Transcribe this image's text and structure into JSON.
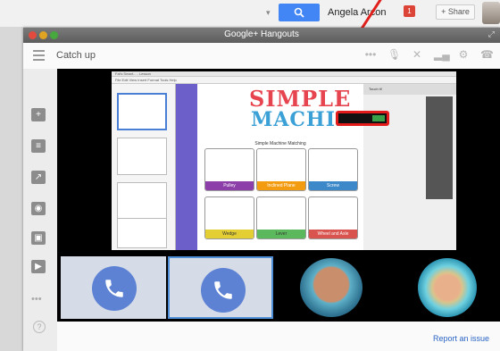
{
  "browser_bar": {
    "user_name": "Angela Arcon",
    "notification_count": "1",
    "share_label": "+ Share"
  },
  "window": {
    "title": "Google+ Hangouts",
    "call_title": "Catch up"
  },
  "toolbar": {
    "icons": [
      "mic-icon",
      "camera-off-icon",
      "signal-icon",
      "settings-icon",
      "leave-call-icon"
    ]
  },
  "sidebar": {
    "items": [
      "invite-people-icon",
      "chat-icon",
      "screenshare-icon",
      "camera-icon",
      "capture-icon",
      "youtube-icon"
    ],
    "more_label": "•••",
    "help_label": "?"
  },
  "shared_screen": {
    "app_title_bar": "Fal's Smart... - Lesson",
    "menu_bar": "File  Edit  View  Insert  Format  Tools  Help",
    "right_header": "Touch it!",
    "lesson_title_line1": "SIMPLE",
    "lesson_title_line2": "MACHINES",
    "subtitle": "Simple Machine Matching",
    "cards": [
      {
        "label": "Pulley",
        "color": "#8c3fa8"
      },
      {
        "label": "Inclined Plane",
        "color": "#f39c12"
      },
      {
        "label": "Screw",
        "color": "#3d88c8"
      },
      {
        "label": "Wedge",
        "color": "#e3cf33"
      },
      {
        "label": "Lever",
        "color": "#5cb85c"
      },
      {
        "label": "Wheel and Axle",
        "color": "#d9534f"
      }
    ]
  },
  "participants": [
    {
      "type": "phone"
    },
    {
      "type": "phone",
      "selected": true
    },
    {
      "type": "video-man"
    },
    {
      "type": "video-woman"
    }
  ],
  "footer": {
    "report_link": "Report an issue"
  },
  "colors": {
    "annotation_red": "#e21b1b",
    "google_blue": "#4285f4",
    "phone_blue": "#5d82d4",
    "link_blue": "#2a64c5"
  }
}
